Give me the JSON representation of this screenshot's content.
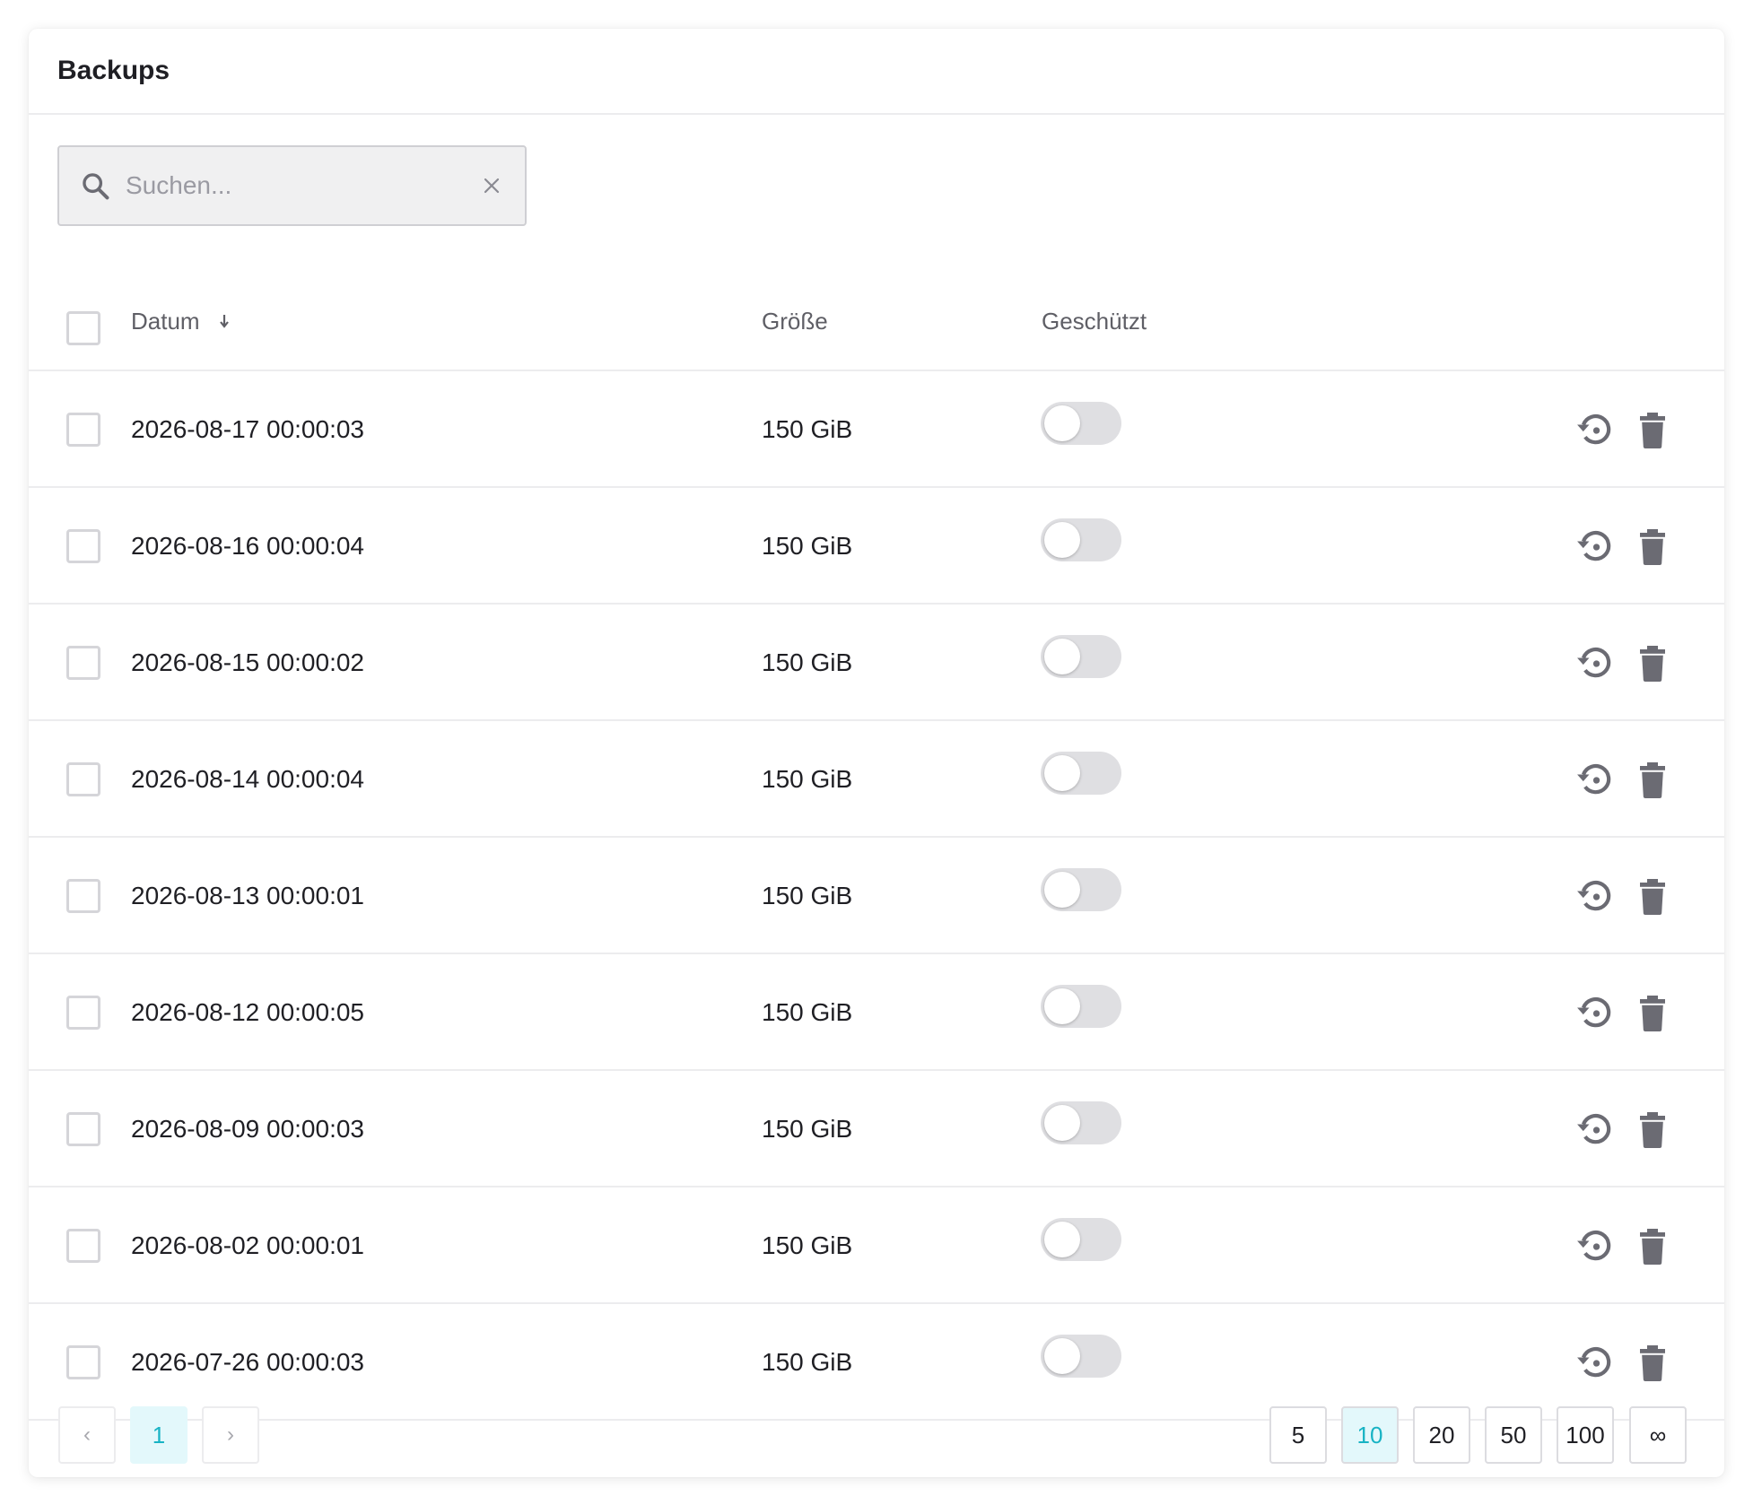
{
  "card": {
    "title": "Backups"
  },
  "search": {
    "placeholder": "Suchen...",
    "value": ""
  },
  "table": {
    "columns": {
      "date": "Datum",
      "size": "Größe",
      "protected": "Geschützt"
    },
    "sort": {
      "column": "Datum",
      "direction": "descending"
    },
    "rows": [
      {
        "date": "2026-08-17 00:00:03",
        "size": "150 GiB",
        "protected": false
      },
      {
        "date": "2026-08-16 00:00:04",
        "size": "150 GiB",
        "protected": false
      },
      {
        "date": "2026-08-15 00:00:02",
        "size": "150 GiB",
        "protected": false
      },
      {
        "date": "2026-08-14 00:00:04",
        "size": "150 GiB",
        "protected": false
      },
      {
        "date": "2026-08-13 00:00:01",
        "size": "150 GiB",
        "protected": false
      },
      {
        "date": "2026-08-12 00:00:05",
        "size": "150 GiB",
        "protected": false
      },
      {
        "date": "2026-08-09 00:00:03",
        "size": "150 GiB",
        "protected": false
      },
      {
        "date": "2026-08-02 00:00:01",
        "size": "150 GiB",
        "protected": false
      },
      {
        "date": "2026-07-26 00:00:03",
        "size": "150 GiB",
        "protected": false
      }
    ]
  },
  "pagination": {
    "prev": "‹",
    "next": "›",
    "current_page": "1",
    "page_sizes": [
      "5",
      "10",
      "20",
      "50",
      "100",
      "∞"
    ],
    "selected_page_size": "10"
  },
  "icons": {
    "search": "search-icon",
    "clear": "close-icon",
    "sort": "arrow-down-icon",
    "restore": "restore-icon",
    "delete": "trash-icon"
  },
  "colors": {
    "accent": "#18b3c4",
    "accent_bg": "#e3f8fb",
    "icon_gray": "#6b6b73",
    "toggle_off": "#dfdfe2"
  }
}
